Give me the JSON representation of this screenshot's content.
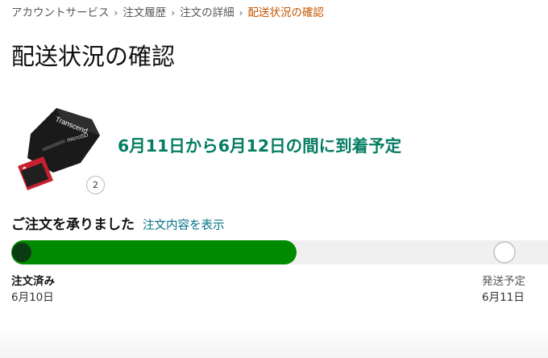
{
  "breadcrumb": {
    "items": [
      "アカウントサービス",
      "注文履歴",
      "注文の詳細"
    ],
    "current": "配送状況の確認",
    "separator": "›"
  },
  "page": {
    "title": "配送状況の確認"
  },
  "product": {
    "image_icon": "microsd-card-image",
    "brand_text": "Transcend",
    "card_label": "microSD",
    "quantity": "2"
  },
  "delivery": {
    "eta": "6月11日から6月12日の間に到着予定",
    "eta_color": "#067D62"
  },
  "status": {
    "heading": "ご注文を承りました",
    "link": "注文内容を表示",
    "link_color": "#007185"
  },
  "progress": {
    "percent": 52,
    "fill_color": "#008A00",
    "steps": [
      {
        "label": "注文済み",
        "date": "6月10日",
        "state": "done"
      },
      {
        "label": "発送予定",
        "date": "6月11日",
        "state": "pending"
      }
    ]
  }
}
